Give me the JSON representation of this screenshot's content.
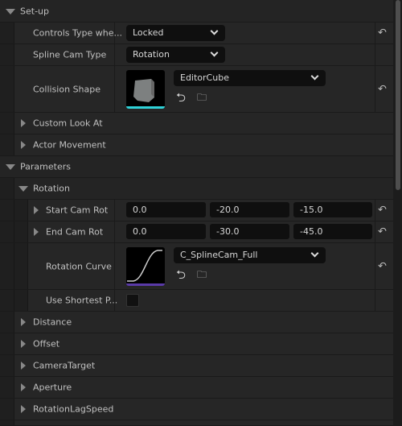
{
  "sections": {
    "setup": {
      "label": "Set-up",
      "icon": "triangle-down-icon"
    },
    "parameters": {
      "label": "Parameters",
      "icon": "triangle-down-icon"
    },
    "rotation": {
      "label": "Rotation",
      "icon": "triangle-down-icon"
    }
  },
  "setup": {
    "controls_type": {
      "label": "Controls Type whe...",
      "value": "Locked"
    },
    "spline_cam_type": {
      "label": "Spline Cam Type",
      "value": "Rotation"
    },
    "collision_shape": {
      "label": "Collision Shape",
      "value": "EditorCube",
      "accent": "#2fd2d8"
    },
    "custom_look_at": "Custom Look At",
    "actor_movement": "Actor Movement"
  },
  "rotation": {
    "start_cam_rot": {
      "label": "Start Cam Rot",
      "x": "0.0",
      "y": "-20.0",
      "z": "-15.0"
    },
    "end_cam_rot": {
      "label": "End Cam Rot",
      "x": "0.0",
      "y": "-30.0",
      "z": "-45.0"
    },
    "rotation_curve": {
      "label": "Rotation Curve",
      "value": "C_SplineCam_Full",
      "accent": "#5a3aa8"
    },
    "use_shortest": {
      "label": "Use Shortest P...",
      "checked": false
    }
  },
  "groups": [
    "Distance",
    "Offset",
    "CameraTarget",
    "Aperture",
    "RotationLagSpeed"
  ],
  "icons": {
    "reset": "↶",
    "use_selected": "⮌",
    "browse": "🔍"
  }
}
